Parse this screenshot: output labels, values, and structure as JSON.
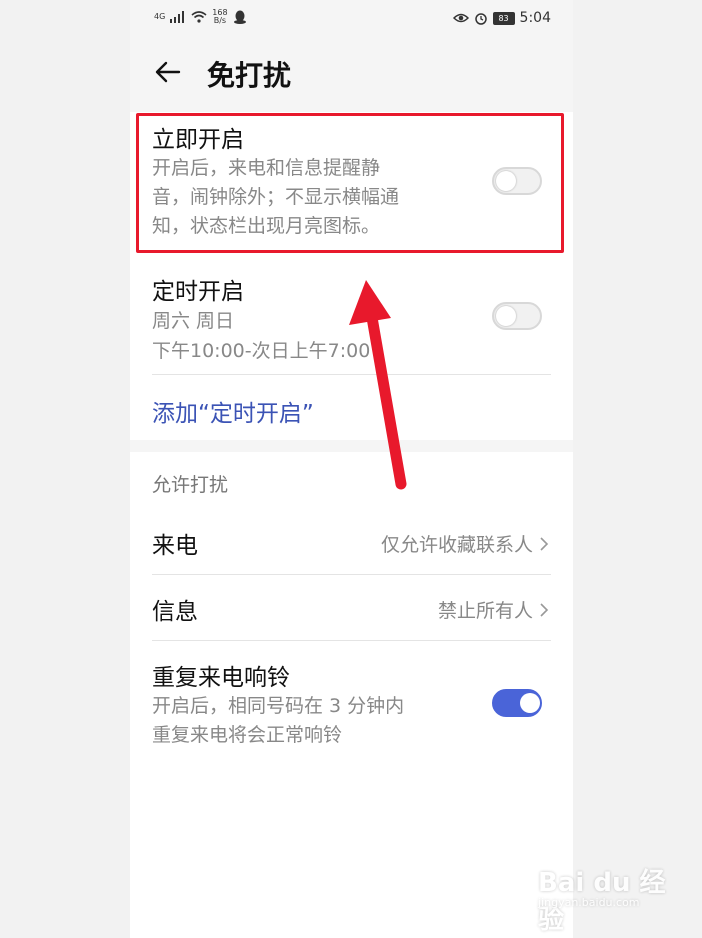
{
  "status": {
    "signal": "4G",
    "speed_value": "168",
    "speed_unit": "B/s",
    "battery": "83",
    "time": "5:04"
  },
  "header": {
    "title": "免打扰"
  },
  "now_on": {
    "title": "立即开启",
    "desc_lines": [
      "开启后，来电和信息提醒静",
      "音，闹钟除外；不显示横幅通",
      "知，状态栏出现月亮图标。"
    ],
    "enabled": false
  },
  "scheduled": {
    "title": "定时开启",
    "days": "周六 周日",
    "time": "下午10:00-次日上午7:00",
    "enabled": false
  },
  "add_schedule": {
    "label": "添加“定时开启”"
  },
  "allow": {
    "section_label": "允许打扰",
    "calls": {
      "title": "来电",
      "value": "仅允许收藏联系人"
    },
    "messages": {
      "title": "信息",
      "value": "禁止所有人"
    },
    "repeat_calls": {
      "title": "重复来电响铃",
      "desc_lines": [
        "开启后，相同号码在 3 分钟内",
        "重复来电将会正常响铃"
      ],
      "enabled": true
    }
  },
  "watermark": {
    "brand": "Bai du 经验",
    "url": "jingyan.baidu.com"
  },
  "colors": {
    "accent": "#4a64d8",
    "link": "#3b53b5",
    "highlight": "#e8192c"
  }
}
